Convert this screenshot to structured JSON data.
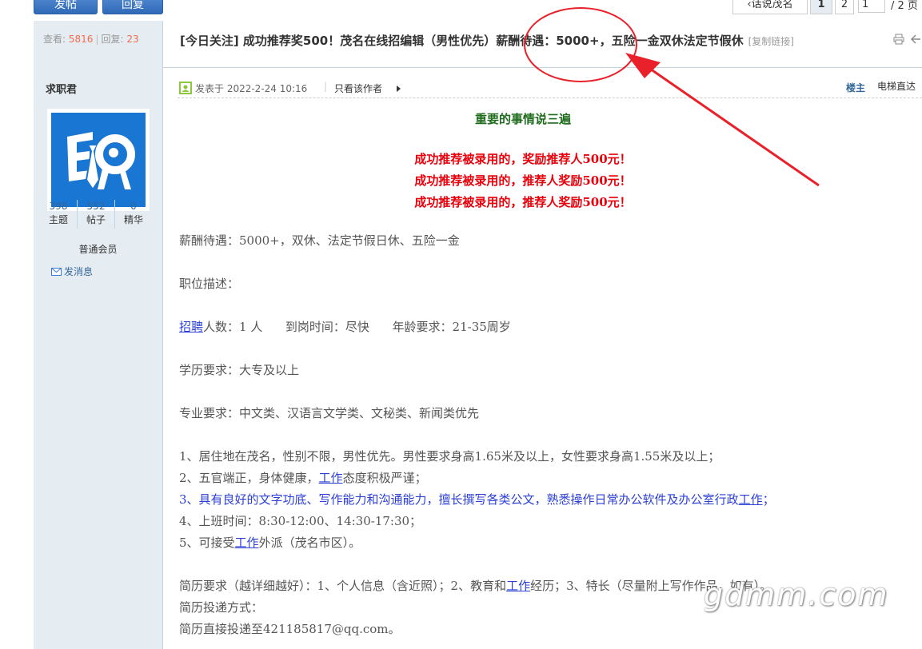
{
  "toolbar": {
    "post_label": "发帖",
    "reply_label": "回复",
    "back_label": "话说茂名",
    "page_current": "1",
    "page_next": "2",
    "page_input": "1",
    "page_total": "/ 2 页"
  },
  "stats": {
    "views_label": "查看:",
    "views": "5816",
    "replies_label": "回复:",
    "replies": "23"
  },
  "thread": {
    "title": "[今日关注] 成功推荐奖500！茂名在线招编辑（男性优先）薪酬待遇：5000+，五险一金双休法定节假休",
    "copy_link": "[复制链接]"
  },
  "author": {
    "name": "求职君",
    "topics": "398",
    "topics_label": "主题",
    "posts": "552",
    "posts_label": "帖子",
    "digest": "0",
    "digest_label": "精华",
    "rank": "普通会员",
    "send_message": "发消息"
  },
  "post": {
    "posted_at": "发表于 2022-2-24 10:16",
    "sep": "|",
    "only_author": "只看该作者",
    "floor": "楼主",
    "elevator": "电梯直达"
  },
  "body": {
    "heading": "重要的事情说三遍",
    "red_lines": [
      "成功推荐被录用的，奖励推荐人500元！",
      "成功推荐被录用的，推荐人奖励500元！",
      "成功推荐被录用的，推荐人奖励500元！"
    ],
    "salary": "薪酬待遇：5000+，双休、法定节假日休、五险一金",
    "job_desc": "职位描述：",
    "recruit_link": "招聘",
    "recruit_rest": "人数：1 人      到岗时间：尽快      年龄要求：21-35周岁",
    "education": "学历要求：大专及以上",
    "major": "专业要求：中文类、汉语言文学类、文秘类、新闻类优先",
    "item1": "1、居住地在茂名，性别不限，男性优先。男性要求身高1.65米及以上，女性要求身高1.55米及以上；",
    "item2_a": "2、五官端正，身体健康，",
    "item2_link": "工作",
    "item2_b": "态度积极严谨；",
    "item3_a": "3、具有良好的文字功底、写作能力和沟通能力，擅长撰写各类公文，熟悉操作日常办公软件及办公室行政",
    "item3_link": "工作",
    "item3_b": "；",
    "item4": "4、上班时间：8:30-12:00、14:30-17:30；",
    "item5_a": "5、可接受",
    "item5_link": "工作",
    "item5_b": "外派（茂名市区）。",
    "resume_a": "简历要求（越详细越好）：1、个人信息（含近照）；2、教育和",
    "resume_link": "工作",
    "resume_b": "经历；3、特长（尽量附上写作作品，如有）。",
    "delivery": "简历投递方式：",
    "email_line": "简历直接投递至421185817@qq.com。"
  },
  "watermark": "gdmm.com",
  "colors": {
    "accent_blue": "#2f6ab8",
    "sidebar_bg": "#e5edf2",
    "heading_green": "#1e6b1e",
    "alert_red": "#e8000b",
    "annotation_red": "#e8212a"
  }
}
